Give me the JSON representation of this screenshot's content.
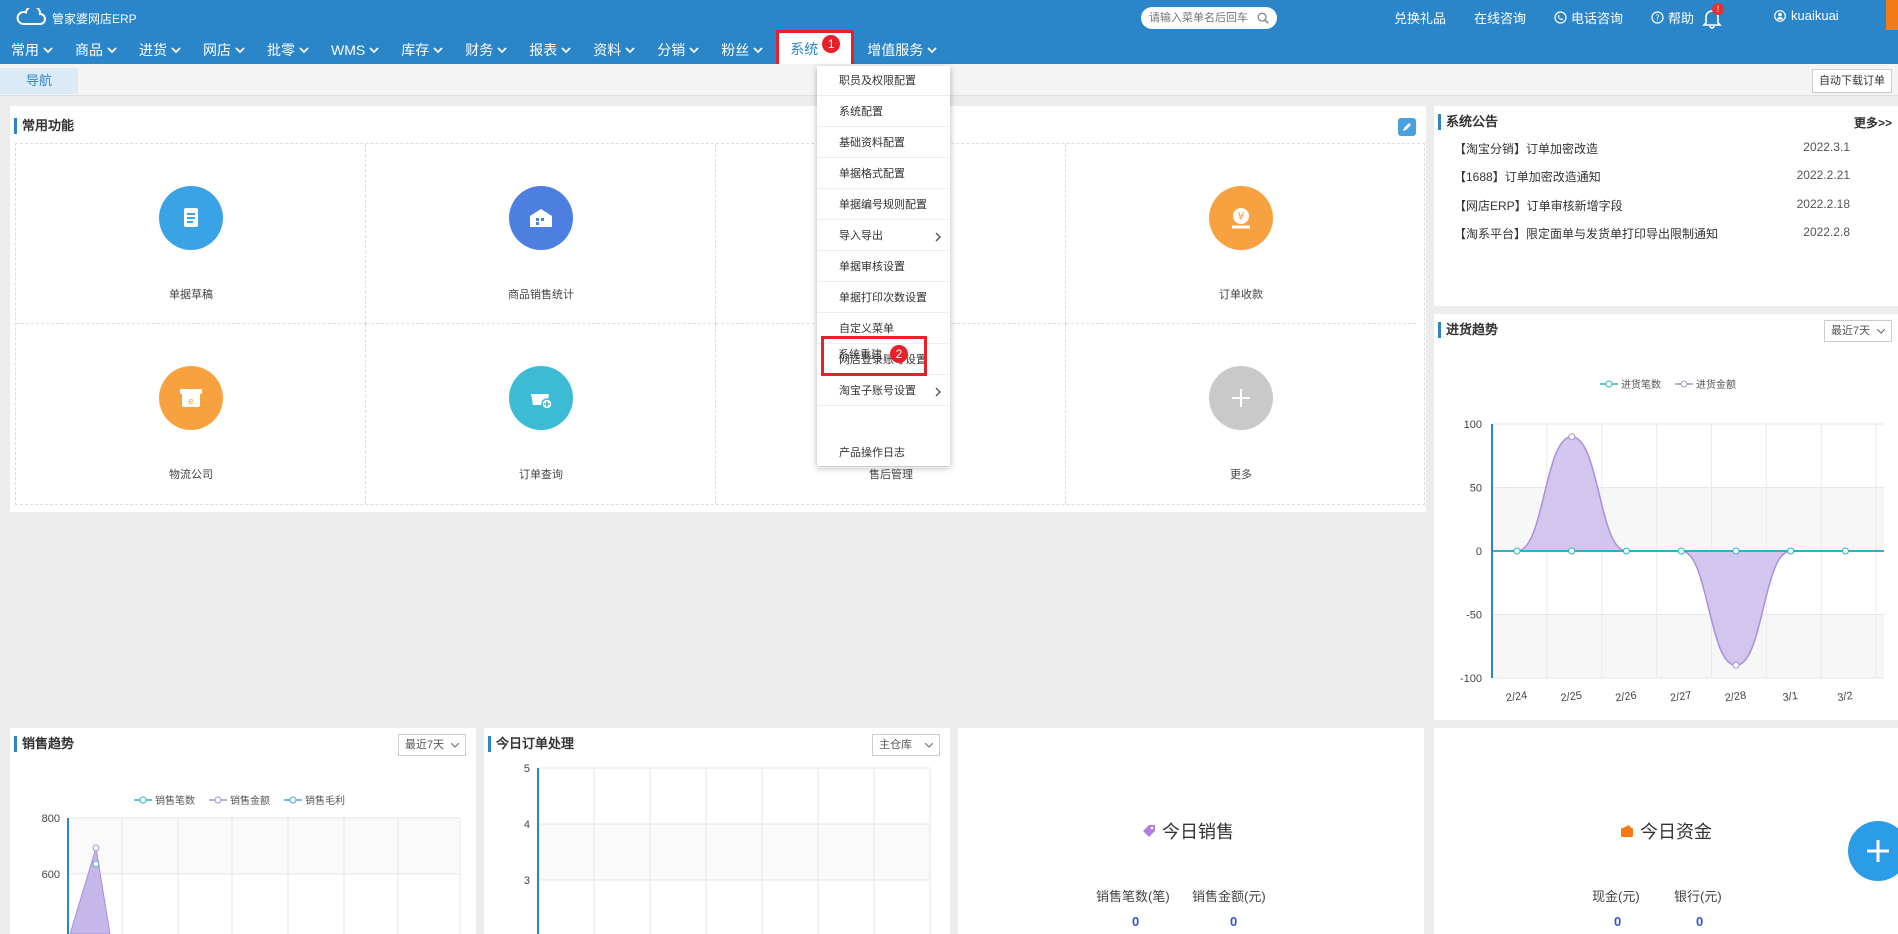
{
  "app": {
    "logo_text": "管家婆网店ERP"
  },
  "search": {
    "placeholder": "请输入菜单名后回车"
  },
  "toplinks": {
    "gift": "兑换礼品",
    "online": "在线咨询",
    "phone": "电话咨询",
    "help": "帮助",
    "bell_badge": "!",
    "user": "kuaikuai"
  },
  "nav": {
    "items": [
      "常用",
      "商品",
      "进货",
      "网店",
      "批零",
      "WMS",
      "库存",
      "财务",
      "报表",
      "资料",
      "分销",
      "粉丝",
      "系统",
      "增值服务"
    ],
    "active_badge": "1"
  },
  "tabs": {
    "nav": "导航",
    "auto_download": "自动下载订单"
  },
  "common": {
    "title": "常用功能",
    "items": [
      "单据草稿",
      "商品销售统计",
      "订单收款",
      "物流公司",
      "订单查询",
      "售后管理",
      "更多"
    ]
  },
  "system_menu": {
    "items": [
      "职员及权限配置",
      "系统配置",
      "基础资料配置",
      "单据格式配置",
      "单据编号规则配置",
      "导入导出",
      "单据审核设置",
      "单据打印次数设置",
      "自定义菜单",
      "网店登录账号设置",
      "淘宝子账号设置",
      "系统重建",
      "产品操作日志"
    ],
    "highlight_badge": "2"
  },
  "announce": {
    "title": "系统公告",
    "more": "更多>>",
    "rows": [
      {
        "text": "【淘宝分销】订单加密改造",
        "date": "2022.3.1"
      },
      {
        "text": "【1688】订单加密改造通知",
        "date": "2022.2.21"
      },
      {
        "text": "【网店ERP】订单审核新增字段",
        "date": "2022.2.18"
      },
      {
        "text": "【淘系平台】限定面单与发货单打印导出限制通知",
        "date": "2022.2.8"
      }
    ]
  },
  "purchase_trend": {
    "title": "进货趋势",
    "select": "最近7天"
  },
  "sales_trend": {
    "title": "销售趋势",
    "select": "最近7天",
    "legend": [
      "销售笔数",
      "销售金额",
      "销售毛利"
    ],
    "yticks": [
      "800",
      "600"
    ]
  },
  "today_orders": {
    "title": "今日订单处理",
    "select": "主仓库",
    "yticks": [
      "5",
      "4",
      "3"
    ]
  },
  "today_sales": {
    "title": "今日销售",
    "count_label": "销售笔数(笔)",
    "amount_label": "销售金额(元)",
    "count": "0",
    "amount": "0"
  },
  "today_funds": {
    "title": "今日资金",
    "cash_label": "现金(元)",
    "bank_label": "银行(元)",
    "cash": "0",
    "bank": "0"
  },
  "chart_data": {
    "type": "area",
    "x": [
      "2/24",
      "2/25",
      "2/26",
      "2/27",
      "2/28",
      "3/1",
      "3/2"
    ],
    "series": [
      {
        "name": "进货笔数",
        "values": [
          0,
          0,
          0,
          0,
          0,
          0,
          0
        ]
      },
      {
        "name": "进货金额",
        "values": [
          0,
          90,
          0,
          0,
          -90,
          0,
          0
        ]
      }
    ],
    "yticks": [
      "100",
      "50",
      "0",
      "-50",
      "-100"
    ],
    "ylim": [
      -100,
      100
    ],
    "legend": "top",
    "colors": {
      "count": "#26b5c6",
      "amount": "#a98fd8"
    }
  }
}
